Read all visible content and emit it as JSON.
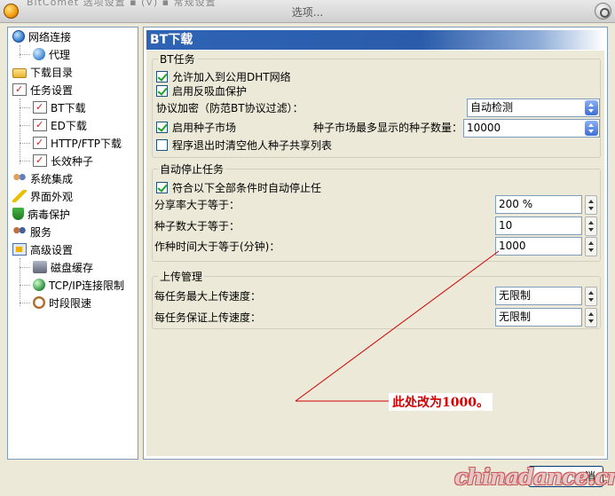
{
  "window": {
    "title": "选项...",
    "cut_title": "BitComet 选项设置 ▪ (V) ▪ 常规设置"
  },
  "tree": {
    "items": [
      {
        "label": "网络连接",
        "icon": "globe-icon"
      },
      {
        "label": "代理",
        "icon": "proxy-icon"
      },
      {
        "label": "下载目录",
        "icon": "folder-icon"
      },
      {
        "label": "任务设置",
        "icon": "task-icon"
      },
      {
        "label": "BT下载",
        "icon": "task-icon"
      },
      {
        "label": "ED下载",
        "icon": "task-icon"
      },
      {
        "label": "HTTP/FTP下载",
        "icon": "task-icon"
      },
      {
        "label": "长效种子",
        "icon": "task-icon"
      },
      {
        "label": "系统集成",
        "icon": "people-icon"
      },
      {
        "label": "界面外观",
        "icon": "brush-icon"
      },
      {
        "label": "病毒保护",
        "icon": "shield-icon"
      },
      {
        "label": "服务",
        "icon": "server-icon"
      },
      {
        "label": "高级设置",
        "icon": "advanced-icon"
      },
      {
        "label": "磁盘缓存",
        "icon": "disk-icon"
      },
      {
        "label": "TCP/IP连接限制",
        "icon": "tcp-icon"
      },
      {
        "label": "时段限速",
        "icon": "clock-icon"
      }
    ]
  },
  "panel": {
    "header": "BT下载",
    "bt_task": {
      "legend": "BT任务",
      "dht_label": "允许加入到公用DHT网络",
      "dht_checked": true,
      "antileech_label": "启用反吸血保护",
      "antileech_checked": true,
      "encryption_label": "协议加密（防范BT协议过滤）：",
      "encryption_value": "自动检测",
      "seed_market_label": "启用种子市场",
      "seed_market_checked": true,
      "seed_max_label": "种子市场最多显示的种子数量：",
      "seed_max_value": "10000",
      "clear_label": "程序退出时清空他人种子共享列表",
      "clear_checked": false
    },
    "auto_stop": {
      "legend": "自动停止任务",
      "all_label": "符合以下全部条件时自动停止任",
      "all_checked": true,
      "ratio_label": "分享率大于等于：",
      "ratio_value": "200 %",
      "seeds_label": "种子数大于等于：",
      "seeds_value": "10",
      "time_label": "作种时间大于等于(分钟)：",
      "time_value": "1000"
    },
    "upload": {
      "legend": "上传管理",
      "max_label": "每任务最大上传速度：",
      "max_value": "无限制",
      "guarantee_label": "每任务保证上传速度：",
      "guarantee_value": "无限制"
    }
  },
  "annotation": {
    "text": "此处改为1000。",
    "color": "#d40000"
  },
  "footer": {
    "button_tail": "消",
    "watermark": "chinadance.cn"
  }
}
